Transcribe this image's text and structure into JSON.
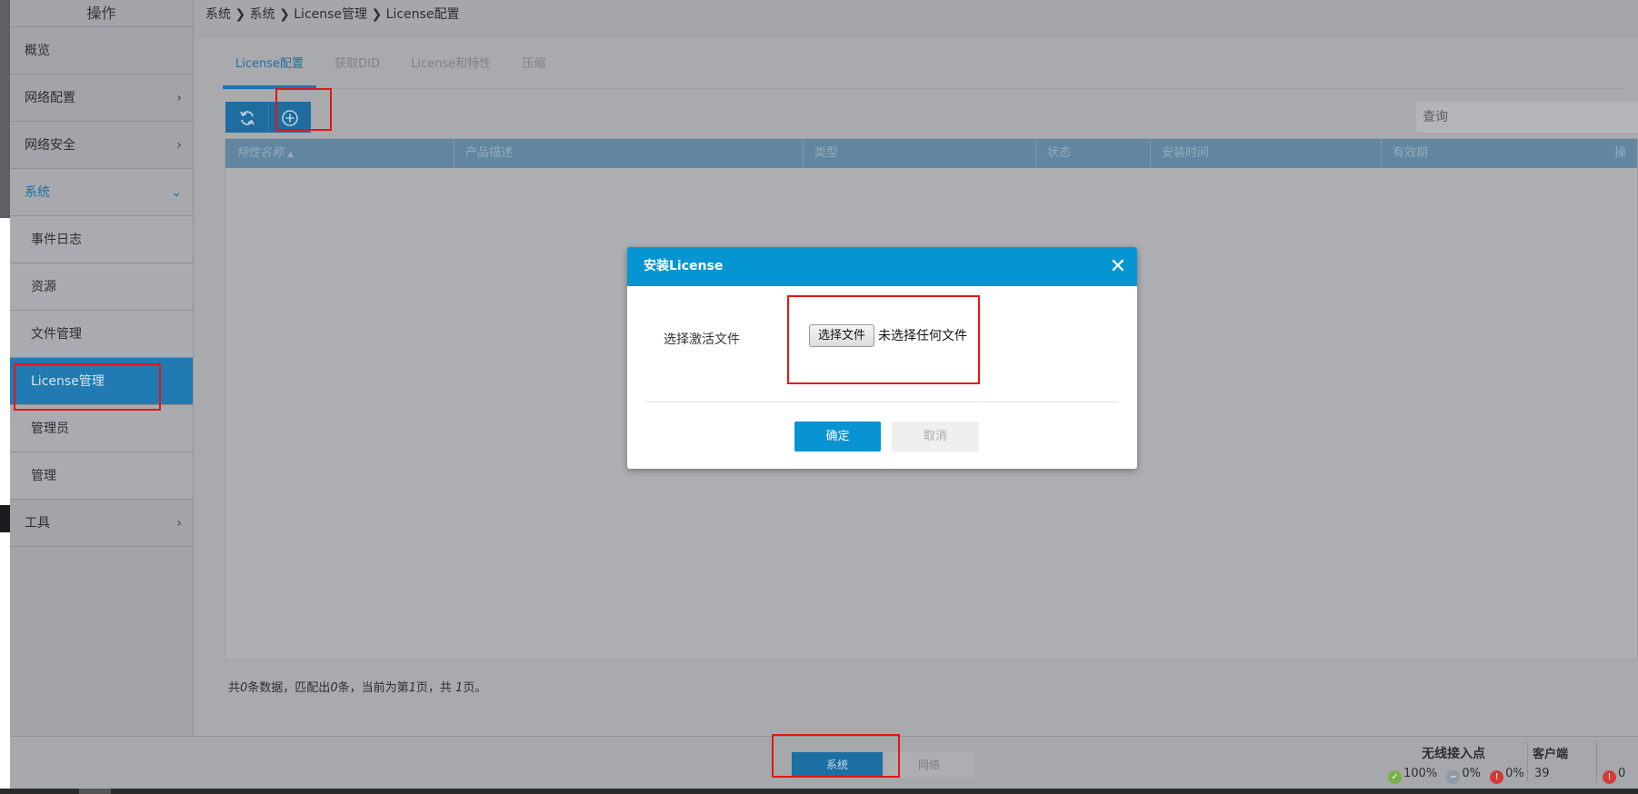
{
  "sidebar": {
    "header": "操作",
    "items": [
      {
        "label": "概览"
      },
      {
        "label": "网络配置",
        "chevron": "›"
      },
      {
        "label": "网络安全",
        "chevron": "›"
      },
      {
        "label": "系统",
        "chevron": "⌄"
      },
      {
        "label": "工具",
        "chevron": "›"
      }
    ],
    "sub_items": [
      {
        "label": "事件日志"
      },
      {
        "label": "资源"
      },
      {
        "label": "文件管理"
      },
      {
        "label": "License管理"
      },
      {
        "label": "管理员"
      },
      {
        "label": "管理"
      }
    ]
  },
  "breadcrumb": "系统 ❯ 系统 ❯ License管理 ❯ License配置",
  "tabs": [
    "License配置",
    "获取DID",
    "License和特性",
    "压缩"
  ],
  "toolbar": {
    "refresh_icon": "refresh-icon",
    "add_icon": "plus-circle-icon"
  },
  "search": {
    "placeholder": "查询"
  },
  "table": {
    "columns": [
      "特性名称",
      "产品描述",
      "类型",
      "状态",
      "安装时间",
      "有效期",
      "操"
    ],
    "sort_indicator": "▲",
    "rows": []
  },
  "pager": {
    "prefix": "共",
    "total": "0",
    "mid1": "条数据，匹配出",
    "matched": "0",
    "mid2": "条，当前为第",
    "current": "1",
    "mid3": "页，共",
    "pages": "1",
    "suffix": "页。"
  },
  "bottombar": {
    "btn_system": "系统",
    "btn_network": "网络",
    "wireless_title": "无线接入点",
    "wireless_ok": "100%",
    "wireless_mid": "0%",
    "wireless_err": "0%",
    "client_title": "客户端",
    "client_count": "39",
    "alarm_count": "0"
  },
  "modal": {
    "title": "安装License",
    "close": "✕",
    "file_label": "选择激活文件",
    "file_button": "选择文件",
    "file_status": "未选择任何文件",
    "ok": "确定",
    "cancel": "取消"
  },
  "colors": {
    "accent": "#0595d3",
    "highlight": "#e21616",
    "sidebar_active": "#217ab1"
  }
}
